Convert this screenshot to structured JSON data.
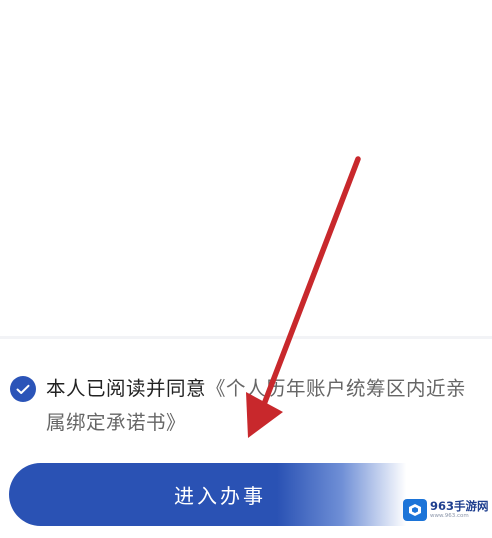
{
  "agreement": {
    "checked": true,
    "prefix": "本人已阅读并同意",
    "document_title": "《个人历年账户统筹区内近亲属绑定承诺书》"
  },
  "primary_action": {
    "label": "进入办事"
  },
  "watermark": {
    "name": "963手游网",
    "domain": "www.963.com"
  },
  "colors": {
    "accent": "#2b54b8",
    "annotation_arrow": "#c8282c"
  }
}
